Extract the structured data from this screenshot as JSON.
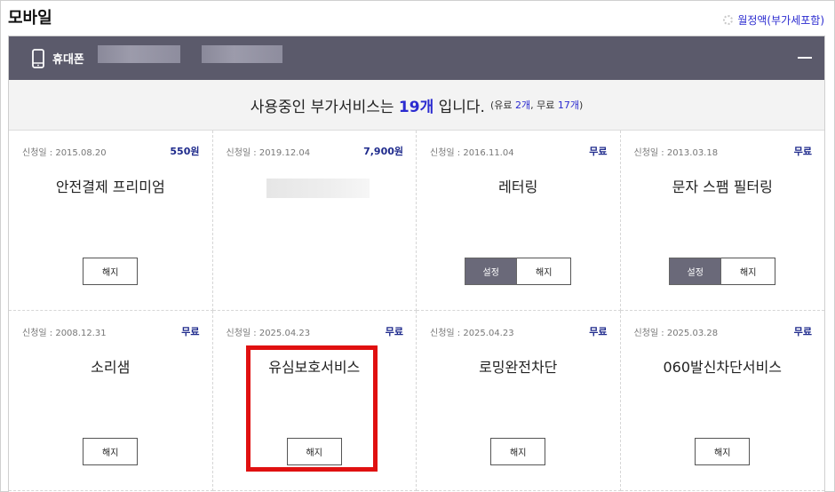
{
  "page": {
    "title": "모바일",
    "monthly_link": "월정액(부가세포함)"
  },
  "device": {
    "label": "휴대폰",
    "icon": "phone-icon"
  },
  "summary": {
    "prefix": "사용중인 부가서비스는 ",
    "count": "19개",
    "suffix": " 입니다.",
    "detail_open": "(유료 ",
    "paid": "2개",
    "detail_mid": ", 무료 ",
    "free": "17개",
    "detail_close": ")"
  },
  "labels": {
    "cancel": "해지",
    "settings": "설정"
  },
  "cards": [
    {
      "date": "신청일 : 2015.08.20",
      "price": "550원",
      "name": "안전결제 프리미엄",
      "has_settings": false
    },
    {
      "date": "신청일 : 2019.12.04",
      "price": "7,900원",
      "name": "",
      "has_settings": false,
      "no_buttons": true
    },
    {
      "date": "신청일 : 2016.11.04",
      "price": "무료",
      "name": "레터링",
      "has_settings": true
    },
    {
      "date": "신청일 : 2013.03.18",
      "price": "무료",
      "name": "문자 스팸 필터링",
      "has_settings": true
    },
    {
      "date": "신청일 : 2008.12.31",
      "price": "무료",
      "name": "소리샘",
      "has_settings": false
    },
    {
      "date": "신청일 : 2025.04.23",
      "price": "무료",
      "name": "유심보호서비스",
      "has_settings": false
    },
    {
      "date": "신청일 : 2025.04.23",
      "price": "무료",
      "name": "로밍완전차단",
      "has_settings": false
    },
    {
      "date": "신청일 : 2025.03.28",
      "price": "무료",
      "name": "060발신차단서비스",
      "has_settings": false
    }
  ],
  "colors": {
    "header_bg": "#5b5a6b",
    "accent_blue": "#2b2bd0",
    "price_navy": "#1e2a8c",
    "highlight_red": "#e01010"
  }
}
